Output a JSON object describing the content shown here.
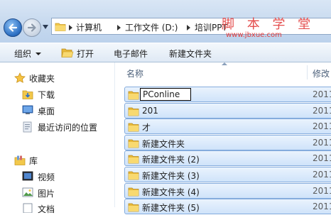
{
  "address_bar": {
    "breadcrumbs": [
      "计算机",
      "工作文件 (D:)",
      "培训PPT"
    ],
    "watermark": "脚 本 学 堂",
    "watermark_url": "www.jbxue.com"
  },
  "toolbar": {
    "organize_label": "组织",
    "open_label": "打开",
    "email_label": "电子邮件",
    "new_folder_label": "新建文件夹"
  },
  "nav_pane": {
    "favorites_label": "收藏夹",
    "favorites": [
      "下载",
      "桌面",
      "最近访问的位置"
    ],
    "library_label": "库",
    "libraries": [
      "视频",
      "图片",
      "文档"
    ]
  },
  "content": {
    "columns": {
      "name": "名称",
      "date": "修改"
    },
    "rows": [
      {
        "name": "PConline",
        "date": "2011",
        "renaming": true
      },
      {
        "name": "201",
        "date": "2011"
      },
      {
        "name": "才",
        "date": "2011"
      },
      {
        "name": "新建文件夹",
        "date": "2011"
      },
      {
        "name": "新建文件夹 (2)",
        "date": "2011"
      },
      {
        "name": "新建文件夹 (3)",
        "date": "2011"
      },
      {
        "name": "新建文件夹 (4)",
        "date": "2011"
      },
      {
        "name": "新建文件夹 (5)",
        "date": "2011"
      }
    ]
  },
  "colors": {
    "selection_fill": "#cfe3fa",
    "selection_border": "#84acdd",
    "folder_yellow": "#f2c84b",
    "watermark_red": "#e23b3b"
  }
}
